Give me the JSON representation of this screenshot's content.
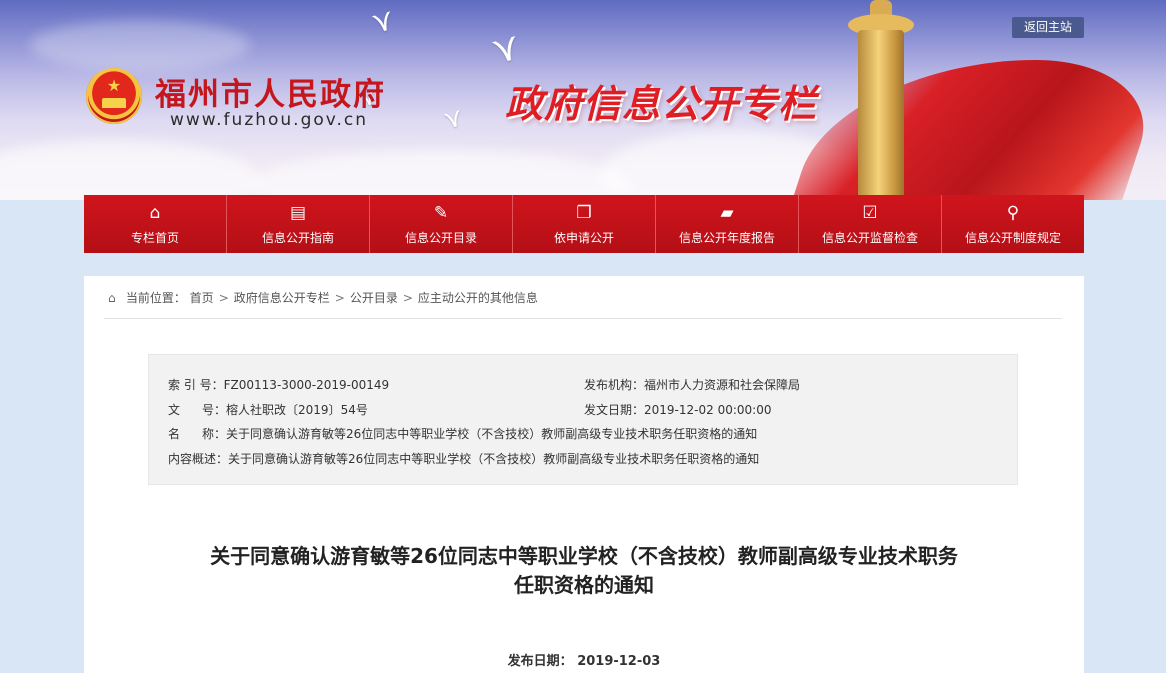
{
  "header": {
    "site_name": "福州市人民政府",
    "site_url": "www.fuzhou.gov.cn",
    "banner_title": "政府信息公开专栏",
    "back_link": "返回主站",
    "emblem_icon": "national-emblem-icon",
    "colors": {
      "brand_red": "#c8121a",
      "title_red": "#e01d23",
      "back_button": "#4b5a8e"
    }
  },
  "nav": {
    "items": [
      {
        "label": "专栏首页",
        "icon": "home-icon"
      },
      {
        "label": "信息公开指南",
        "icon": "guide-document-icon"
      },
      {
        "label": "信息公开目录",
        "icon": "catalog-icon"
      },
      {
        "label": "依申请公开",
        "icon": "copy-document-icon"
      },
      {
        "label": "信息公开年度报告",
        "icon": "folder-icon"
      },
      {
        "label": "信息公开监督检查",
        "icon": "checklist-icon"
      },
      {
        "label": "信息公开制度规定",
        "icon": "magnifier-icon"
      }
    ]
  },
  "breadcrumb": {
    "prefix": "当前位置：",
    "items": [
      "首页",
      "政府信息公开专栏",
      "公开目录",
      "应主动公开的其他信息"
    ],
    "separator": ">"
  },
  "meta": {
    "index_label": "索 引 号：",
    "index_value": "FZ00113-3000-2019-00149",
    "publisher_label": "发布机构：",
    "publisher_value": "福州市人力资源和社会保障局",
    "docno_label_a": "文",
    "docno_label_b": "号：",
    "docno_value": "榕人社职改〔2019〕54号",
    "date_label": "发文日期：",
    "date_value": "2019-12-02 00:00:00",
    "name_label_a": "名",
    "name_label_b": "称：",
    "name_value": "关于同意确认游育敏等26位同志中等职业学校（不含技校）教师副高级专业技术职务任职资格的通知",
    "summary_label": "内容概述：",
    "summary_value": "关于同意确认游育敏等26位同志中等职业学校（不含技校）教师副高级专业技术职务任职资格的通知"
  },
  "article": {
    "title_line1": "关于同意确认游育敏等26位同志中等职业学校（不含技校）教师副高级专业技术职务",
    "title_line2": "任职资格的通知",
    "pub_date_label": "发布日期：",
    "pub_date_value": "2019-12-03"
  }
}
